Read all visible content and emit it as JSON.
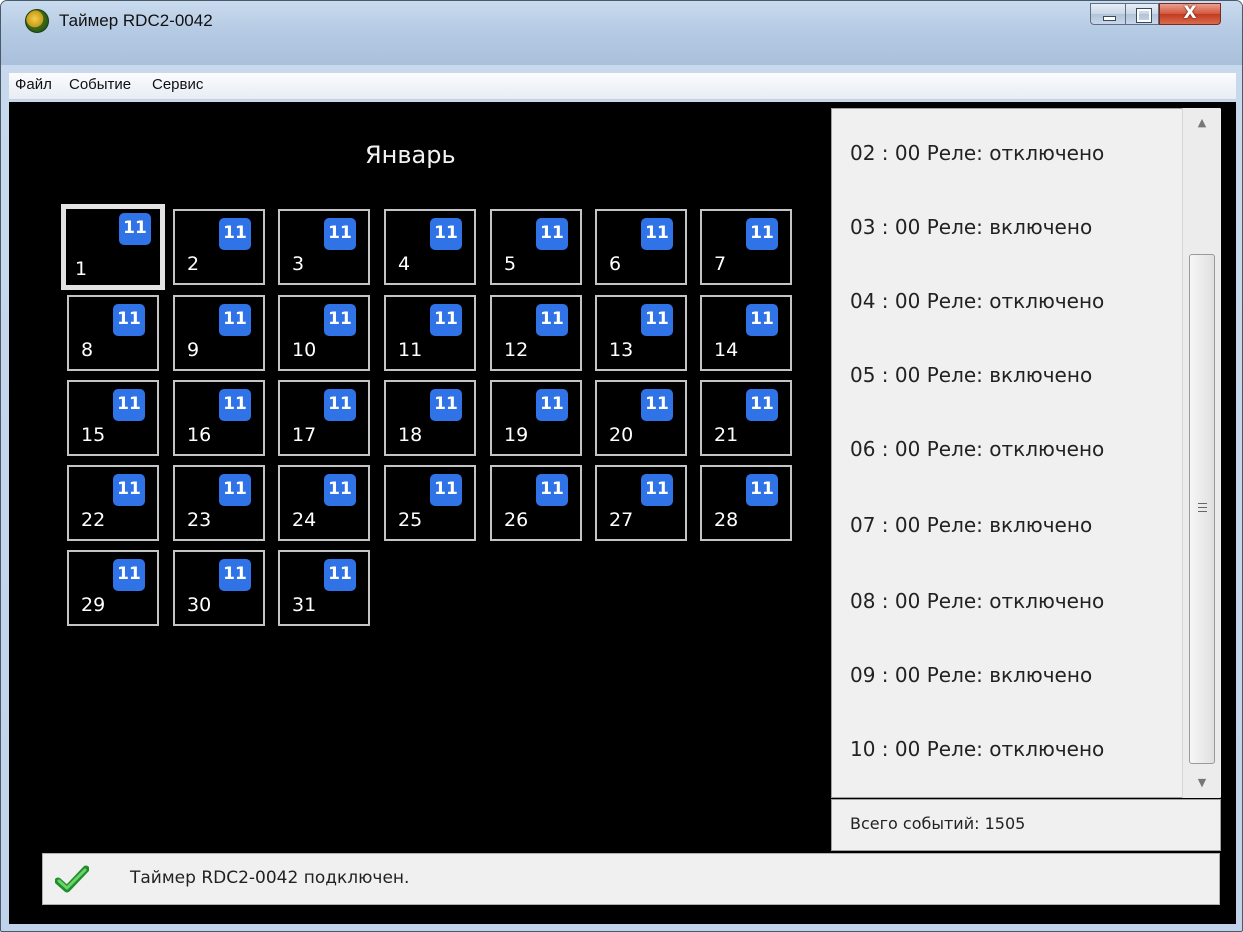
{
  "window": {
    "title": "Таймер RDC2-0042",
    "close_glyph": "X"
  },
  "menu": {
    "items": [
      "Файл",
      "Событие",
      "Сервис"
    ]
  },
  "calendar": {
    "month": "Январь",
    "selected_day": 1,
    "days": [
      {
        "num": "1",
        "badge": "11"
      },
      {
        "num": "2",
        "badge": "11"
      },
      {
        "num": "3",
        "badge": "11"
      },
      {
        "num": "4",
        "badge": "11"
      },
      {
        "num": "5",
        "badge": "11"
      },
      {
        "num": "6",
        "badge": "11"
      },
      {
        "num": "7",
        "badge": "11"
      },
      {
        "num": "8",
        "badge": "11"
      },
      {
        "num": "9",
        "badge": "11"
      },
      {
        "num": "10",
        "badge": "11"
      },
      {
        "num": "11",
        "badge": "11"
      },
      {
        "num": "12",
        "badge": "11"
      },
      {
        "num": "13",
        "badge": "11"
      },
      {
        "num": "14",
        "badge": "11"
      },
      {
        "num": "15",
        "badge": "11"
      },
      {
        "num": "16",
        "badge": "11"
      },
      {
        "num": "17",
        "badge": "11"
      },
      {
        "num": "18",
        "badge": "11"
      },
      {
        "num": "19",
        "badge": "11"
      },
      {
        "num": "20",
        "badge": "11"
      },
      {
        "num": "21",
        "badge": "11"
      },
      {
        "num": "22",
        "badge": "11"
      },
      {
        "num": "23",
        "badge": "11"
      },
      {
        "num": "24",
        "badge": "11"
      },
      {
        "num": "25",
        "badge": "11"
      },
      {
        "num": "26",
        "badge": "11"
      },
      {
        "num": "27",
        "badge": "11"
      },
      {
        "num": "28",
        "badge": "11"
      },
      {
        "num": "29",
        "badge": "11"
      },
      {
        "num": "30",
        "badge": "11"
      },
      {
        "num": "31",
        "badge": "11"
      }
    ],
    "badge_color": "#2f73e6"
  },
  "events": {
    "items": [
      "02 : 00  Реле: отключено",
      "03 : 00  Реле: включено",
      "04 : 00  Реле: отключено",
      "05 : 00  Реле: включено",
      "06 : 00  Реле: отключено",
      "07 : 00  Реле: включено",
      "08 : 00  Реле: отключено",
      "09 : 00  Реле: включено",
      "10 : 00  Реле: отключено"
    ],
    "total": "Всего событий: 1505"
  },
  "status": {
    "icon": "check-icon",
    "text": "Таймер RDC2-0042 подключен."
  }
}
